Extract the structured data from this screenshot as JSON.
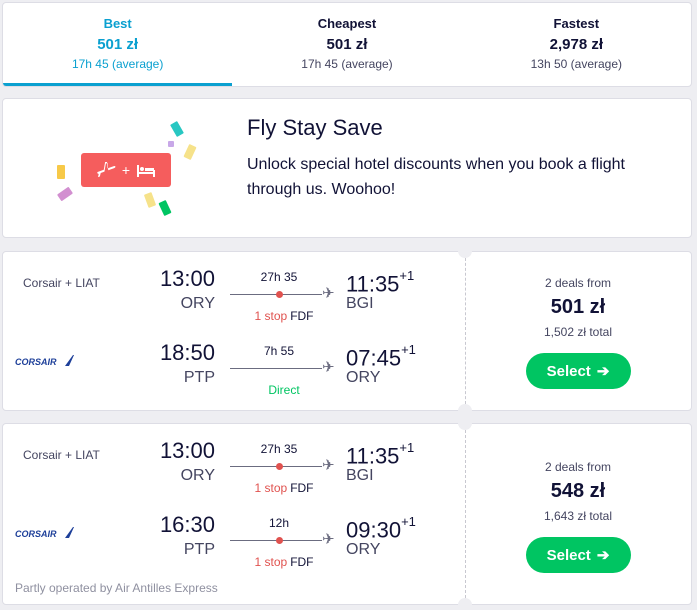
{
  "sort_tabs": [
    {
      "label": "Best",
      "price": "501 zł",
      "duration": "17h 45 (average)",
      "active": true
    },
    {
      "label": "Cheapest",
      "price": "501 zł",
      "duration": "17h 45 (average)",
      "active": false
    },
    {
      "label": "Fastest",
      "price": "2,978 zł",
      "duration": "13h 50 (average)",
      "active": false
    }
  ],
  "promo": {
    "title": "Fly Stay Save",
    "text": "Unlock special hotel discounts when you book a flight through us. Woohoo!",
    "tag_plus": "+"
  },
  "results": [
    {
      "airline_name": "Corsair + LIAT",
      "logo_text": "CORSAIR",
      "legs": [
        {
          "dep_time": "13:00",
          "dep_airport": "ORY",
          "duration": "27h 35",
          "stops_label": "1 stop",
          "stop_airport": "FDF",
          "arr_time": "11:35",
          "day_offset": "+1",
          "arr_airport": "BGI"
        },
        {
          "dep_time": "18:50",
          "dep_airport": "PTP",
          "duration": "7h 55",
          "stops_label": "Direct",
          "stop_airport": "",
          "arr_time": "07:45",
          "day_offset": "+1",
          "arr_airport": "ORY"
        }
      ],
      "deals": "2 deals from",
      "price": "501 zł",
      "total": "1,502 zł total",
      "select_label": "Select",
      "operated_by": ""
    },
    {
      "airline_name": "Corsair + LIAT",
      "logo_text": "CORSAIR",
      "legs": [
        {
          "dep_time": "13:00",
          "dep_airport": "ORY",
          "duration": "27h 35",
          "stops_label": "1 stop",
          "stop_airport": "FDF",
          "arr_time": "11:35",
          "day_offset": "+1",
          "arr_airport": "BGI"
        },
        {
          "dep_time": "16:30",
          "dep_airport": "PTP",
          "duration": "12h",
          "stops_label": "1 stop",
          "stop_airport": "FDF",
          "arr_time": "09:30",
          "day_offset": "+1",
          "arr_airport": "ORY"
        }
      ],
      "deals": "2 deals from",
      "price": "548 zł",
      "total": "1,643 zł total",
      "select_label": "Select",
      "operated_by": "Partly operated by Air Antilles Express"
    }
  ],
  "colors": {
    "accent": "#0aa0d0",
    "select_green": "#00c562",
    "stop_red": "#e0524f",
    "corsair_blue": "#1d3f99",
    "promo_red": "#f55d5d"
  }
}
